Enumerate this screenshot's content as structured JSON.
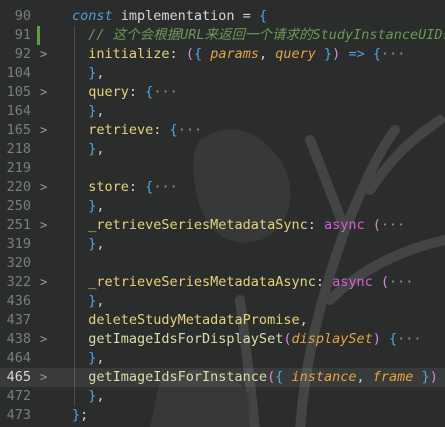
{
  "editor": {
    "lines": [
      {
        "num": "90",
        "fold": "",
        "tokens": [
          {
            "t": "const",
            "c": "kw"
          },
          {
            "t": " implementation ",
            "c": "default"
          },
          {
            "t": "=",
            "c": "op"
          },
          {
            "t": " ",
            "c": "default"
          },
          {
            "t": "{",
            "c": "brace"
          }
        ]
      },
      {
        "num": "91",
        "fold": "",
        "modified": true,
        "tokens": [
          {
            "t": "  // 这个会根据URL来返回一个请求的StudyInstanceUIDs",
            "c": "comment"
          }
        ]
      },
      {
        "num": "92",
        "fold": ">",
        "tokens": [
          {
            "t": "  initialize",
            "c": "prop"
          },
          {
            "t": ": ",
            "c": "punc"
          },
          {
            "t": "(",
            "c": "paren"
          },
          {
            "t": "{",
            "c": "brace"
          },
          {
            "t": " params",
            "c": "param"
          },
          {
            "t": ", ",
            "c": "punc"
          },
          {
            "t": "query",
            "c": "param"
          },
          {
            "t": " }",
            "c": "brace"
          },
          {
            "t": ")",
            "c": "paren"
          },
          {
            "t": " => ",
            "c": "kw"
          },
          {
            "t": "{",
            "c": "brace"
          },
          {
            "t": "···",
            "c": "fold"
          }
        ]
      },
      {
        "num": "104",
        "fold": "",
        "tokens": [
          {
            "t": "  }",
            "c": "brace"
          },
          {
            "t": ",",
            "c": "punc"
          }
        ]
      },
      {
        "num": "105",
        "fold": ">",
        "tokens": [
          {
            "t": "  query",
            "c": "prop"
          },
          {
            "t": ": ",
            "c": "punc"
          },
          {
            "t": "{",
            "c": "brace"
          },
          {
            "t": "···",
            "c": "fold"
          }
        ]
      },
      {
        "num": "164",
        "fold": "",
        "tokens": [
          {
            "t": "  }",
            "c": "brace"
          },
          {
            "t": ",",
            "c": "punc"
          }
        ]
      },
      {
        "num": "165",
        "fold": ">",
        "tokens": [
          {
            "t": "  retrieve",
            "c": "prop"
          },
          {
            "t": ": ",
            "c": "punc"
          },
          {
            "t": "{",
            "c": "brace"
          },
          {
            "t": "···",
            "c": "fold"
          }
        ]
      },
      {
        "num": "218",
        "fold": "",
        "tokens": [
          {
            "t": "  }",
            "c": "brace"
          },
          {
            "t": ",",
            "c": "punc"
          }
        ]
      },
      {
        "num": "219",
        "fold": "",
        "tokens": []
      },
      {
        "num": "220",
        "fold": ">",
        "tokens": [
          {
            "t": "  store",
            "c": "prop"
          },
          {
            "t": ": ",
            "c": "punc"
          },
          {
            "t": "{",
            "c": "brace"
          },
          {
            "t": "···",
            "c": "fold"
          }
        ]
      },
      {
        "num": "250",
        "fold": "",
        "tokens": [
          {
            "t": "  }",
            "c": "brace"
          },
          {
            "t": ",",
            "c": "punc"
          }
        ]
      },
      {
        "num": "251",
        "fold": ">",
        "tokens": [
          {
            "t": "  _retrieveSeriesMetadataSync",
            "c": "prop"
          },
          {
            "t": ": ",
            "c": "punc"
          },
          {
            "t": "async",
            "c": "kw2"
          },
          {
            "t": " ",
            "c": "default"
          },
          {
            "t": "(",
            "c": "paren"
          },
          {
            "t": "···",
            "c": "fold"
          }
        ]
      },
      {
        "num": "319",
        "fold": "",
        "tokens": [
          {
            "t": "  }",
            "c": "brace"
          },
          {
            "t": ",",
            "c": "punc"
          }
        ]
      },
      {
        "num": "320",
        "fold": "",
        "tokens": []
      },
      {
        "num": "322",
        "fold": ">",
        "tokens": [
          {
            "t": "  _retrieveSeriesMetadataAsync",
            "c": "prop"
          },
          {
            "t": ": ",
            "c": "punc"
          },
          {
            "t": "async",
            "c": "kw2"
          },
          {
            "t": " ",
            "c": "default"
          },
          {
            "t": "(",
            "c": "paren"
          },
          {
            "t": "···",
            "c": "fold"
          }
        ]
      },
      {
        "num": "436",
        "fold": "",
        "tokens": [
          {
            "t": "  }",
            "c": "brace"
          },
          {
            "t": ",",
            "c": "punc"
          }
        ]
      },
      {
        "num": "437",
        "fold": "",
        "tokens": [
          {
            "t": "  deleteStudyMetadataPromise",
            "c": "prop"
          },
          {
            "t": ",",
            "c": "punc"
          }
        ]
      },
      {
        "num": "438",
        "fold": ">",
        "tokens": [
          {
            "t": "  getImageIdsForDisplaySet",
            "c": "fn"
          },
          {
            "t": "(",
            "c": "paren"
          },
          {
            "t": "displaySet",
            "c": "param"
          },
          {
            "t": ")",
            "c": "paren"
          },
          {
            "t": " ",
            "c": "default"
          },
          {
            "t": "{",
            "c": "brace"
          },
          {
            "t": "···",
            "c": "fold"
          }
        ]
      },
      {
        "num": "464",
        "fold": "",
        "tokens": [
          {
            "t": "  }",
            "c": "brace"
          },
          {
            "t": ",",
            "c": "punc"
          }
        ]
      },
      {
        "num": "465",
        "fold": ">",
        "active": true,
        "tokens": [
          {
            "t": "  getImageIdsForInstance",
            "c": "fn"
          },
          {
            "t": "(",
            "c": "paren"
          },
          {
            "t": "{",
            "c": "brace"
          },
          {
            "t": " instance",
            "c": "param"
          },
          {
            "t": ", ",
            "c": "punc"
          },
          {
            "t": "frame",
            "c": "param"
          },
          {
            "t": " }",
            "c": "brace"
          },
          {
            "t": ")",
            "c": "paren"
          },
          {
            "t": " ",
            "c": "default"
          },
          {
            "t": "{",
            "c": "brace"
          },
          {
            "t": "···",
            "c": "fold"
          }
        ]
      },
      {
        "num": "472",
        "fold": "",
        "tokens": [
          {
            "t": "  }",
            "c": "brace"
          },
          {
            "t": ",",
            "c": "punc"
          }
        ]
      },
      {
        "num": "473",
        "fold": "",
        "tokens": [
          {
            "t": "}",
            "c": "brace"
          },
          {
            "t": ";",
            "c": "punc"
          }
        ]
      }
    ]
  },
  "colors": {
    "background": "#2b2d2c",
    "line_number": "#7a7e7c",
    "active_line_number": "#d7d7d7",
    "modified_gutter": "#5f9c3d"
  }
}
